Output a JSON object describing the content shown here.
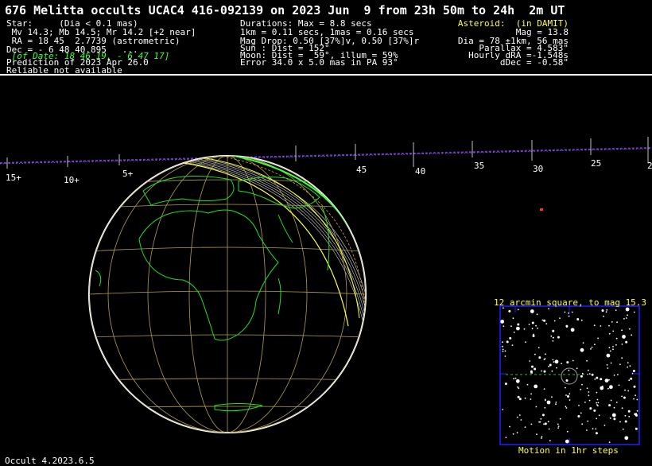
{
  "title": "676 Melitta occults UCAC4 416-092139 on 2023 Jun  9 from 23h 50m to 24h  2m UT",
  "star": {
    "line1": "Star:     (Dia < 0.1 mas)",
    "line2": " Mv 14.3; Mb 14.5; Mr 14.2 [+2 near]",
    "line3": " RA = 18 45  2.7739 (astrometric)",
    "line4": "Dec = - 6 48 40.895   ...",
    "line5": " [of Date: 18 46 19, - 6 47 17]",
    "line6": "Prediction of 2023 Apr 26.0",
    "line7": "Reliable not available"
  },
  "event": {
    "line1": "Durations: Max = 8.8 secs",
    "line2": "1km = 0.11 secs, 1mas = 0.16 secs",
    "line3": "Mag Drop: 0.50 [37%]v, 0.50 [37%]r",
    "line4": "Sun : Dist = 152°",
    "line5": "Moon: Dist =  59°, illum = 59%",
    "line6": "Error 34.0 x 5.0 mas in PA 93°"
  },
  "asteroid": {
    "heading": "Asteroid:  (in DAMIT)",
    "line1": "Mag = 13.8",
    "line2": "Dia = 78 ±1km, 56 mas",
    "line3": "Parallax = 4.583\"",
    "line4": "Hourly dRA =-1.548s",
    "line5": "dDec = -0.58\""
  },
  "timeline_labels": [
    "15+",
    "10+",
    "5+",
    "45",
    "40",
    "35",
    "30",
    "25",
    "2"
  ],
  "starchart": {
    "top_label": "12 arcmin square, to mag 15.3",
    "bottom_label": "Motion in 1hr steps"
  },
  "footer": "Occult 4.2023.6.5"
}
